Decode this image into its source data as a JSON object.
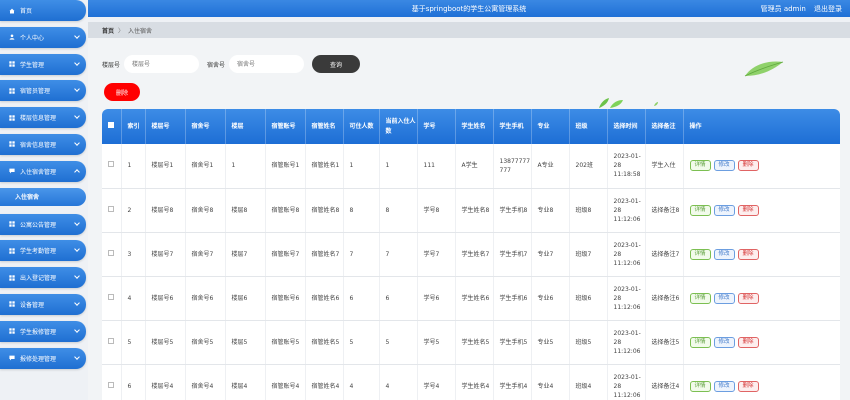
{
  "app": {
    "title": "基于springboot的学生公寓管理系统",
    "user_role": "管理员 admin",
    "logout_label": "退出登录"
  },
  "sidebar": {
    "items": [
      {
        "label": "首页",
        "icon": "home-icon",
        "chevron": false
      },
      {
        "label": "个人中心",
        "icon": "user-icon",
        "chevron": true
      },
      {
        "label": "学生管理",
        "icon": "grid-icon",
        "chevron": true
      },
      {
        "label": "宿管员管理",
        "icon": "grid-icon",
        "chevron": true
      },
      {
        "label": "楼层信息管理",
        "icon": "grid-icon",
        "chevron": true
      },
      {
        "label": "宿舍信息管理",
        "icon": "grid-icon",
        "chevron": true
      },
      {
        "label": "入住宿舍管理",
        "icon": "chat-icon",
        "chevron": true,
        "expanded": true
      },
      {
        "label": "公寓公告管理",
        "icon": "grid-icon",
        "chevron": true
      },
      {
        "label": "学生考勤管理",
        "icon": "grid-icon",
        "chevron": true
      },
      {
        "label": "出入登记管理",
        "icon": "grid-icon",
        "chevron": true
      },
      {
        "label": "设备管理",
        "icon": "grid-icon",
        "chevron": true
      },
      {
        "label": "学生报修管理",
        "icon": "grid-icon",
        "chevron": true
      },
      {
        "label": "报修处理管理",
        "icon": "chat-icon",
        "chevron": true
      }
    ],
    "submenu_active": "入住宿舍"
  },
  "breadcrumb": {
    "home": "首页",
    "separator": "〉",
    "current": "入住宿舍"
  },
  "search": {
    "floor_label": "楼层号",
    "floor_placeholder": "楼层号",
    "room_label": "宿舍号",
    "room_placeholder": "宿舍号",
    "search_button": "查询"
  },
  "delete_button": "删除",
  "table": {
    "headers": [
      "索引",
      "楼层号",
      "宿舍号",
      "楼层",
      "宿管账号",
      "宿管姓名",
      "可住人数",
      "当前入住人数",
      "学号",
      "学生姓名",
      "学生手机",
      "专业",
      "班级",
      "选择时间",
      "选择备注",
      "操作"
    ],
    "rows": [
      {
        "idx": "1",
        "floor_no": "楼层号1",
        "room_no": "宿舍号1",
        "floor": "1",
        "mgr_acct": "宿管账号1",
        "mgr_name": "宿管姓名1",
        "capacity": "1",
        "current": "1",
        "student_no": "111",
        "student_name": "A学生",
        "phone": "13877777777",
        "major": "A专业",
        "class": "202班",
        "time": "2023-01-28 11:18:58",
        "note": "学生入住"
      },
      {
        "idx": "2",
        "floor_no": "楼层号8",
        "room_no": "宿舍号8",
        "floor": "楼层8",
        "mgr_acct": "宿管账号8",
        "mgr_name": "宿管姓名8",
        "capacity": "8",
        "current": "8",
        "student_no": "学号8",
        "student_name": "学生姓名8",
        "phone": "学生手机8",
        "major": "专业8",
        "class": "班级8",
        "time": "2023-01-28 11:12:06",
        "note": "选择备注8"
      },
      {
        "idx": "3",
        "floor_no": "楼层号7",
        "room_no": "宿舍号7",
        "floor": "楼层7",
        "mgr_acct": "宿管账号7",
        "mgr_name": "宿管姓名7",
        "capacity": "7",
        "current": "7",
        "student_no": "学号7",
        "student_name": "学生姓名7",
        "phone": "学生手机7",
        "major": "专业7",
        "class": "班级7",
        "time": "2023-01-28 11:12:06",
        "note": "选择备注7"
      },
      {
        "idx": "4",
        "floor_no": "楼层号6",
        "room_no": "宿舍号6",
        "floor": "楼层6",
        "mgr_acct": "宿管账号6",
        "mgr_name": "宿管姓名6",
        "capacity": "6",
        "current": "6",
        "student_no": "学号6",
        "student_name": "学生姓名6",
        "phone": "学生手机6",
        "major": "专业6",
        "class": "班级6",
        "time": "2023-01-28 11:12:06",
        "note": "选择备注6"
      },
      {
        "idx": "5",
        "floor_no": "楼层号5",
        "room_no": "宿舍号5",
        "floor": "楼层5",
        "mgr_acct": "宿管账号5",
        "mgr_name": "宿管姓名5",
        "capacity": "5",
        "current": "5",
        "student_no": "学号5",
        "student_name": "学生姓名5",
        "phone": "学生手机5",
        "major": "专业5",
        "class": "班级5",
        "time": "2023-01-28 11:12:06",
        "note": "选择备注5"
      },
      {
        "idx": "6",
        "floor_no": "楼层号4",
        "room_no": "宿舍号4",
        "floor": "楼层4",
        "mgr_acct": "宿管账号4",
        "mgr_name": "宿管姓名4",
        "capacity": "4",
        "current": "4",
        "student_no": "学号4",
        "student_name": "学生姓名4",
        "phone": "学生手机4",
        "major": "专业4",
        "class": "班级4",
        "time": "2023-01-28 11:12:06",
        "note": "选择备注4"
      }
    ],
    "actions": {
      "detail": "详情",
      "edit": "修改",
      "delete": "删除"
    }
  },
  "colors": {
    "primary": "#1f6fd2",
    "danger": "#ff0000",
    "dark_button": "#3a3a3a"
  }
}
